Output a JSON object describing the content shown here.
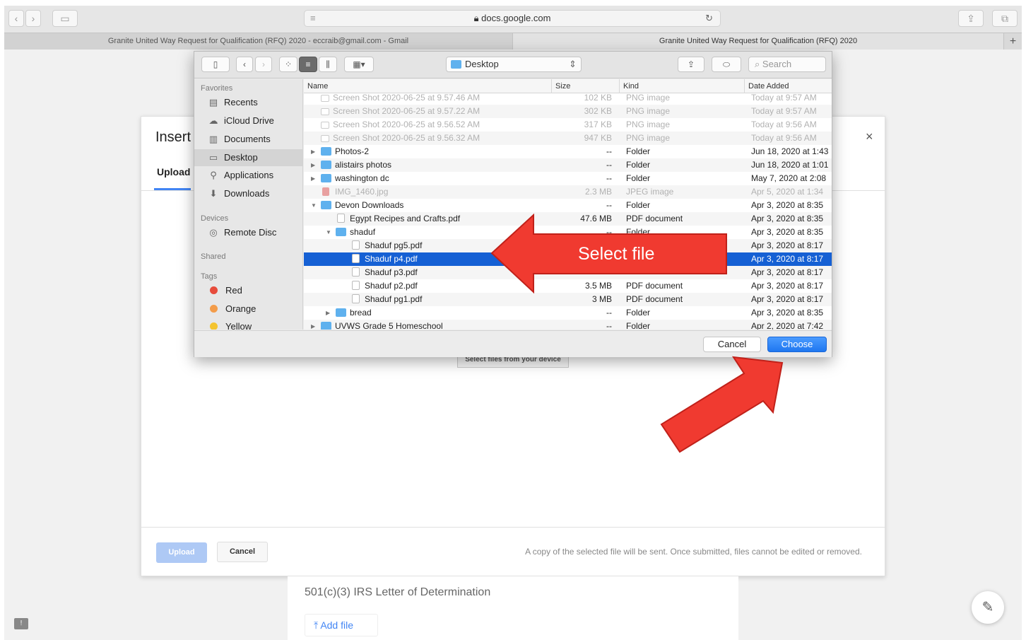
{
  "browser": {
    "url": "docs.google.com",
    "tabs": [
      {
        "label": "Granite United Way Request for Qualification (RFQ) 2020 - eccraib@gmail.com - Gmail"
      },
      {
        "label": "Granite United Way Request for Qualification (RFQ) 2020"
      }
    ],
    "new_tab_label": "+"
  },
  "insert_dialog": {
    "title": "Insert",
    "tab_upload": "Upload",
    "select_device_label": "Select files from your device",
    "upload_button": "Upload",
    "cancel_button": "Cancel",
    "note": "A copy of the selected file will be sent. Once submitted, files cannot be edited or removed.",
    "close": "×"
  },
  "form": {
    "irs_label": "501(c)(3) IRS Letter of Determination",
    "add_file": "Add file"
  },
  "finder": {
    "location": "Desktop",
    "search_placeholder": "Search",
    "sidebar": {
      "favorites_heading": "Favorites",
      "favorites": [
        {
          "label": "Recents",
          "icon": "recents-icon"
        },
        {
          "label": "iCloud Drive",
          "icon": "cloud-icon"
        },
        {
          "label": "Documents",
          "icon": "document-icon"
        },
        {
          "label": "Desktop",
          "icon": "desktop-icon"
        },
        {
          "label": "Applications",
          "icon": "applications-icon"
        },
        {
          "label": "Downloads",
          "icon": "download-icon"
        }
      ],
      "devices_heading": "Devices",
      "devices": [
        {
          "label": "Remote Disc",
          "icon": "disc-icon"
        }
      ],
      "shared_heading": "Shared",
      "tags_heading": "Tags",
      "tags": [
        {
          "label": "Red",
          "color": "#e74c3c"
        },
        {
          "label": "Orange",
          "color": "#f39c4a"
        },
        {
          "label": "Yellow",
          "color": "#f4c430"
        }
      ]
    },
    "columns": {
      "name": "Name",
      "size": "Size",
      "kind": "Kind",
      "date": "Date Added"
    },
    "rows": [
      {
        "name": "Screen Shot 2020-06-25 at 9.57.46 AM",
        "size": "102 KB",
        "kind": "PNG image",
        "date": "Today at 9:57 AM"
      },
      {
        "name": "Screen Shot 2020-06-25 at 9.57.22 AM",
        "size": "302 KB",
        "kind": "PNG image",
        "date": "Today at 9:57 AM"
      },
      {
        "name": "Screen Shot 2020-06-25 at 9.56.52 AM",
        "size": "317 KB",
        "kind": "PNG image",
        "date": "Today at 9:56 AM"
      },
      {
        "name": "Screen Shot 2020-06-25 at 9.56.32 AM",
        "size": "947 KB",
        "kind": "PNG image",
        "date": "Today at 9:56 AM"
      },
      {
        "name": "Photos-2",
        "size": "--",
        "kind": "Folder",
        "date": "Jun 18, 2020 at 1:43"
      },
      {
        "name": "alistairs photos",
        "size": "--",
        "kind": "Folder",
        "date": "Jun 18, 2020 at 1:01"
      },
      {
        "name": "washington dc",
        "size": "--",
        "kind": "Folder",
        "date": "May 7, 2020 at 2:08"
      },
      {
        "name": "IMG_1460.jpg",
        "size": "2.3 MB",
        "kind": "JPEG image",
        "date": "Apr 5, 2020 at 1:34"
      },
      {
        "name": "Devon Downloads",
        "size": "--",
        "kind": "Folder",
        "date": "Apr 3, 2020 at 8:35"
      },
      {
        "name": "Egypt Recipes and Crafts.pdf",
        "size": "47.6 MB",
        "kind": "PDF document",
        "date": "Apr 3, 2020 at 8:35"
      },
      {
        "name": "shaduf",
        "size": "--",
        "kind": "Folder",
        "date": "Apr 3, 2020 at 8:35"
      },
      {
        "name": "Shaduf pg5.pdf",
        "size": "",
        "kind": "",
        "date": "Apr 3, 2020 at 8:17"
      },
      {
        "name": "Shaduf p4.pdf",
        "size": "",
        "kind": "",
        "date": "Apr 3, 2020 at 8:17"
      },
      {
        "name": "Shaduf p3.pdf",
        "size": "",
        "kind": "",
        "date": "Apr 3, 2020 at 8:17"
      },
      {
        "name": "Shaduf p2.pdf",
        "size": "3.5 MB",
        "kind": "PDF document",
        "date": "Apr 3, 2020 at 8:17"
      },
      {
        "name": "Shaduf pg1.pdf",
        "size": "3 MB",
        "kind": "PDF document",
        "date": "Apr 3, 2020 at 8:17"
      },
      {
        "name": "bread",
        "size": "--",
        "kind": "Folder",
        "date": "Apr 3, 2020 at 8:35"
      },
      {
        "name": "UVWS Grade 5 Homeschool",
        "size": "--",
        "kind": "Folder",
        "date": "Apr 2, 2020 at 7:42"
      }
    ],
    "cancel_button": "Cancel",
    "choose_button": "Choose"
  },
  "annotation": {
    "select_label": "Select file",
    "arrow_color": "#f03a30"
  }
}
